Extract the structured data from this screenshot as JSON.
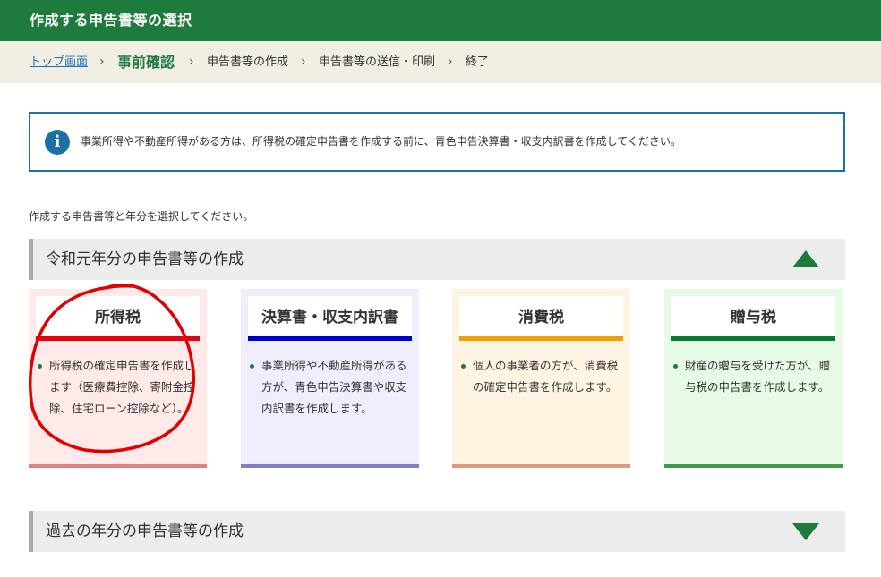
{
  "header": {
    "title": "作成する申告書等の選択"
  },
  "breadcrumb": {
    "items": [
      {
        "label": "トップ画面",
        "state": "link"
      },
      {
        "label": "事前確認",
        "state": "current"
      },
      {
        "label": "申告書等の作成",
        "state": "pending"
      },
      {
        "label": "申告書等の送信・印刷",
        "state": "pending"
      },
      {
        "label": "終了",
        "state": "pending"
      }
    ],
    "separator": "›"
  },
  "info": {
    "icon": "info-icon",
    "icon_glyph": "i",
    "text": "事業所得や不動産所得がある方は、所得税の確定申告書を作成する前に、青色申告決算書・収支内訳書を作成してください。"
  },
  "instruction": "作成する申告書等と年分を選択してください。",
  "current_year_section": {
    "title": "令和元年分の申告書等の作成",
    "toggle": "collapse-arrow-up-icon",
    "cards": [
      {
        "title": "所得税",
        "description": "所得税の確定申告書を作成します（医療費控除、寄附金控除、住宅ローン控除など）。",
        "accent_color": "#e60012",
        "background": "#ffe9e9",
        "footer_color": "#e08080"
      },
      {
        "title": "決算書・収支内訳書",
        "description": "事業所得や不動産所得がある方が、青色申告決算書や収支内訳書を作成します。",
        "accent_color": "#0000cc",
        "background": "#eeeeff",
        "footer_color": "#7f7fcc"
      },
      {
        "title": "消費税",
        "description": "個人の事業者の方が、消費税の確定申告書を作成します。",
        "accent_color": "#f0a000",
        "background": "#fff4e2",
        "footer_color": "#e09a7a"
      },
      {
        "title": "贈与税",
        "description": "財産の贈与を受けた方が、贈与税の申告書を作成します。",
        "accent_color": "#0a7a28",
        "background": "#e6fae6",
        "footer_color": "#3c9a4a"
      }
    ]
  },
  "past_year_section": {
    "title": "過去の年分の申告書等の作成",
    "toggle": "expand-arrow-down-icon"
  },
  "colors": {
    "header_green": "#1f7a3e",
    "breadcrumb_bg": "#f1efe4",
    "info_border": "#1d6fa8",
    "annotation_red": "#e00000"
  }
}
